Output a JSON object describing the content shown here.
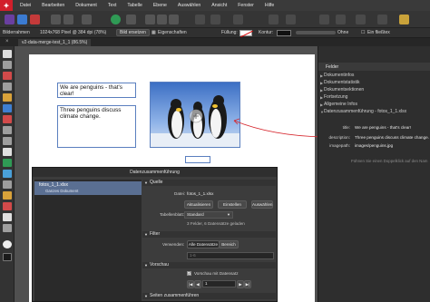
{
  "menubar": {
    "items": [
      "Datei",
      "Bearbeiten",
      "Dokument",
      "Text",
      "Tabelle",
      "Ebene",
      "Auswählen",
      "Ansicht",
      "Fenster",
      "Hilfe"
    ]
  },
  "contextbar": {
    "object_type": "Bilderrahmen",
    "image_info": "1024x768 Pixel @ 384 dpi (78%)",
    "replace_image": "Bild ersetzen",
    "properties": "Eigenschaften",
    "fill_label": "Füllung:",
    "stroke_label": "Kontur:",
    "stroke_value": "Ohne",
    "wrap_label": "Ein fließtex"
  },
  "document_tab": {
    "title": "v2-data-merge-test_1_1 (86.5%)"
  },
  "canvas": {
    "frame1_text": "We are penguins - that's clear!",
    "frame2_text": "Three penguins discuss climate change."
  },
  "right_panel": {
    "tab": "Felder",
    "items": [
      "Dokumentinfos",
      "Dokumentstatistik",
      "Dokumentsektionen",
      "Fortsetzung",
      "Allgemeine Infos",
      "Datenzusammenführung - fotos_1_1.xlsx"
    ],
    "fields": [
      {
        "key": "title:",
        "value": "We are penguins - that's clear!"
      },
      {
        "key": "description:",
        "value": "Three penguins discuss climate change."
      },
      {
        "key": "imagepath:",
        "value": "images/penguins.jpg"
      }
    ],
    "hint": "Fühnen Sie einen Doppelklick auf den Nam"
  },
  "dialog": {
    "title": "Datenzusammenführung",
    "source_name": "fotos_1_1.xlsx",
    "source_sub": "Ganzes Dokument",
    "section_source": "Quelle",
    "data_label": "Datei:",
    "data_value": "fotos_1_1.xlsx",
    "btn_update": "Aktualisieren",
    "btn_settings": "Einstellen",
    "btn_choose": "Auswählen",
    "sheet_label": "Tabellenblatt:",
    "sheet_value": "Standard",
    "loaded_info": "3 Felder, 6 Datensätze geladen",
    "section_filter": "Filter",
    "use_label": "Verwenden:",
    "use_all": "Alle Datensätze",
    "use_range": "Bereich",
    "range_value": "1-6",
    "section_preview": "Vorschau",
    "preview_checkbox": "Vorschau mit Datensatz",
    "record_value": "1",
    "section_pages": "Seiten zusammenführen"
  },
  "colors": {
    "accent_red": "#d21f2b",
    "annotation_red": "#d6262d",
    "selection_blue": "#5a6f92"
  }
}
